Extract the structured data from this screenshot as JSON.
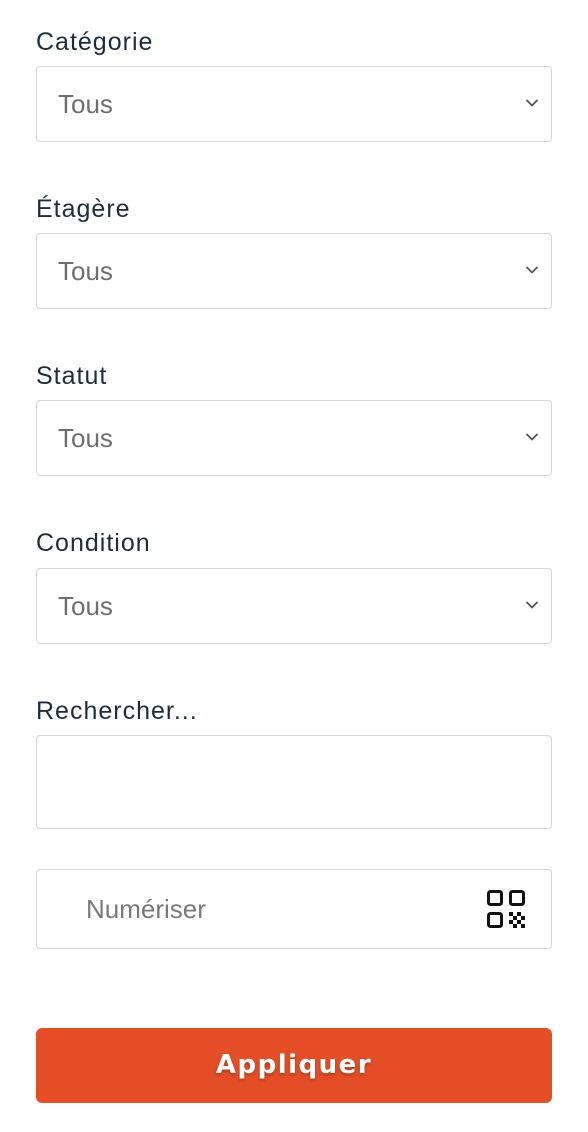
{
  "filters": [
    {
      "label": "Catégorie",
      "value": "Tous"
    },
    {
      "label": "Étagère",
      "value": "Tous"
    },
    {
      "label": "Statut",
      "value": "Tous"
    },
    {
      "label": "Condition",
      "value": "Tous"
    }
  ],
  "search": {
    "label": "Rechercher...",
    "value": ""
  },
  "scan": {
    "placeholder": "Numériser",
    "icon": "qr-code-icon"
  },
  "actions": {
    "apply_label": "Appliquer"
  },
  "colors": {
    "accent": "#e54e26",
    "label_text": "#1f2d3a",
    "placeholder_text": "#6e6e6e",
    "border": "#d6d6d6"
  }
}
